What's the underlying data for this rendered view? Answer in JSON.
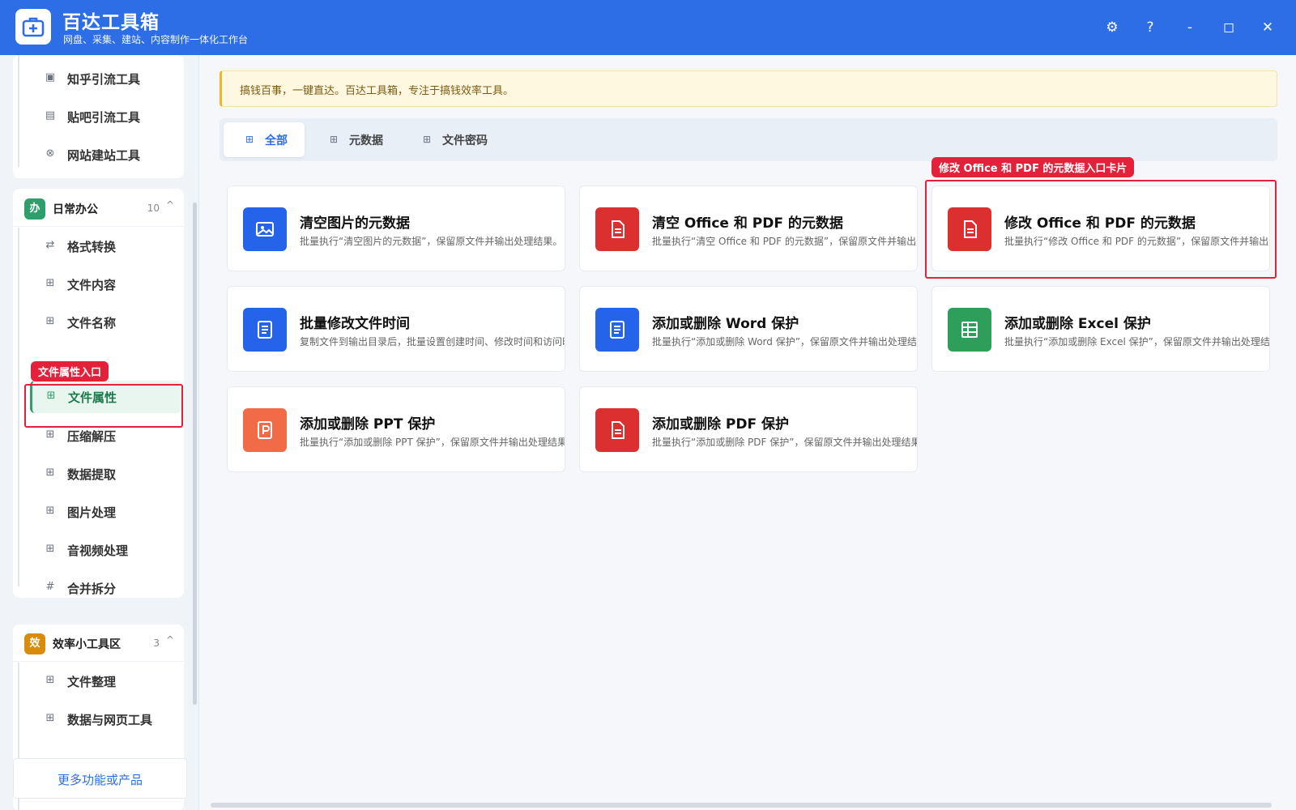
{
  "app": {
    "title": "百达工具箱",
    "subtitle": "网盘、采集、建站、内容制作一体化工作台",
    "controls": {
      "settings": "⚙",
      "help": "?",
      "minimize": "-",
      "maximize": "◻",
      "close": "✕"
    }
  },
  "sidebar": {
    "top_items": [
      {
        "label": "知乎引流工具",
        "icon": "zhihu-icon"
      },
      {
        "label": "贴吧引流工具",
        "icon": "tieba-icon"
      },
      {
        "label": "网站建站工具",
        "icon": "website-icon"
      }
    ],
    "group_office": {
      "badge": "办",
      "title": "日常办公",
      "count": "10",
      "chevron": "^",
      "badge_color": "#2e9e6a",
      "items": [
        {
          "label": "格式转换",
          "icon": "swap-icon"
        },
        {
          "label": "文件内容",
          "icon": "grid-icon"
        },
        {
          "label": "文件名称",
          "icon": "grid-icon"
        },
        {
          "label": "文件属性",
          "icon": "grid-icon",
          "active": true
        },
        {
          "label": "压缩解压",
          "icon": "grid-icon"
        },
        {
          "label": "数据提取",
          "icon": "grid-icon"
        },
        {
          "label": "图片处理",
          "icon": "grid-icon"
        },
        {
          "label": "音视频处理",
          "icon": "grid-icon"
        },
        {
          "label": "合并拆分",
          "icon": "hash-icon"
        }
      ]
    },
    "group_efficiency": {
      "badge": "效",
      "title": "效率小工具区",
      "count": "3",
      "chevron": "^",
      "badge_color": "#d98b0b",
      "items": [
        {
          "label": "文件整理",
          "icon": "grid-icon"
        },
        {
          "label": "数据与网页工具",
          "icon": "grid-icon"
        }
      ]
    },
    "more_label": "更多功能或产品"
  },
  "annotations": {
    "sidebar_callout": "文件属性入口",
    "card_callout": "修改 Office 和 PDF 的元数据入口卡片",
    "color": "#e3213b"
  },
  "main": {
    "notice": "搞钱百事，一键直达。百达工具箱，专注于搞钱效率工具。",
    "tabs": [
      {
        "label": "全部",
        "active": true
      },
      {
        "label": "元数据"
      },
      {
        "label": "文件密码"
      }
    ],
    "cards": [
      {
        "title": "清空图片的元数据",
        "desc": "批量执行“清空图片的元数据”，保留原文件并输出处理结果。",
        "color": "#2563eb",
        "icon": "image-icon"
      },
      {
        "title": "清空 Office 和 PDF 的元数据",
        "desc": "批量执行“清空 Office 和 PDF 的元数据”，保留原文件并输出处理结果。",
        "color": "#dc2f2f",
        "icon": "document-icon"
      },
      {
        "title": "修改 Office 和 PDF 的元数据",
        "desc": "批量执行“修改 Office 和 PDF 的元数据”，保留原文件并输出处理结果。",
        "color": "#dc2f2f",
        "icon": "document-icon"
      },
      {
        "title": "批量修改文件时间",
        "desc": "复制文件到输出目录后，批量设置创建时间、修改时间和访问时间。",
        "color": "#2563eb",
        "icon": "file-text-icon"
      },
      {
        "title": "添加或删除 Word 保护",
        "desc": "批量执行“添加或删除 Word 保护”，保留原文件并输出处理结果。",
        "color": "#2563eb",
        "icon": "word-icon"
      },
      {
        "title": "添加或删除 Excel 保护",
        "desc": "批量执行“添加或删除 Excel 保护”，保留原文件并输出处理结果。",
        "color": "#2e9e5b",
        "icon": "excel-icon"
      },
      {
        "title": "添加或删除 PPT 保护",
        "desc": "批量执行“添加或删除 PPT 保护”，保留原文件并输出处理结果。",
        "color": "#f06b46",
        "icon": "ppt-icon"
      },
      {
        "title": "添加或删除 PDF 保护",
        "desc": "批量执行“添加或删除 PDF 保护”，保留原文件并输出处理结果。",
        "color": "#dc2f2f",
        "icon": "pdf-icon"
      }
    ]
  }
}
